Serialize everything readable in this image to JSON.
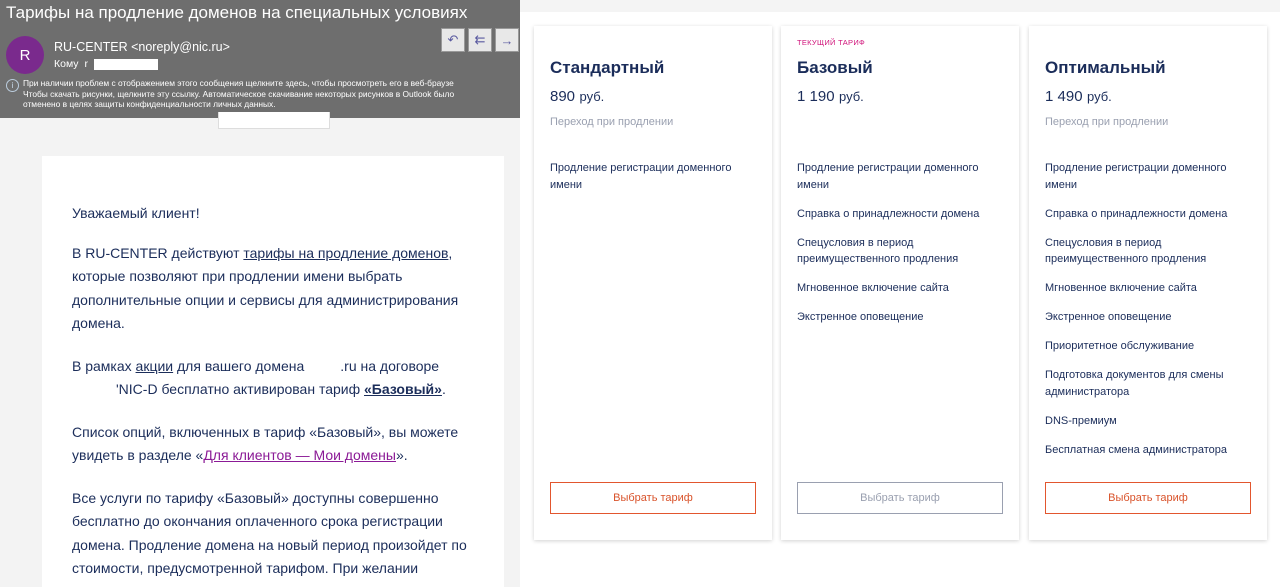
{
  "email": {
    "subject": "Тарифы на продление доменов на специальных условиях",
    "avatar_letter": "R",
    "from": "RU-CENTER <noreply@nic.ru>",
    "to_label": "Кому",
    "to_prefix": "r",
    "info_lines": [
      "При наличии проблем с отображением этого сообщения щелкните здесь, чтобы просмотреть его в веб-браузе",
      "Чтобы скачать рисунки, щелкните эту ссылку. Автоматическое скачивание некоторых рисунков в Outlook было",
      "отменено в целях защиты конфиденциальности личных данных."
    ],
    "actions": [
      "reply",
      "reply-all",
      "forward"
    ]
  },
  "letter": {
    "greeting": "Уважаемый клиент!",
    "p1_before": "В RU-CENTER действуют ",
    "p1_link": "тарифы на продление доменов",
    "p1_after": ", которые позволяют при продлении имени выбрать дополнительные опции и сервисы для администрирования домена.",
    "p2_before": "В рамках ",
    "p2_link": "акции",
    "p2_mid": " для вашего домена",
    "p2_ru": ".ru на договоре",
    "p2_contract": "'NIC-D бесплатно активирован тариф ",
    "p2_tariff": "«Базовый»",
    "p2_end": ".",
    "p3_before": "Список опций, включенных в тариф «Базовый», вы можете увидеть в разделе «",
    "p3_link": "Для клиентов — Мои домены",
    "p3_after": "».",
    "p4": "Все услуги по тарифу «Базовый» доступны совершенно бесплатно до окончания оплаченного срока регистрации домена. Продление домена на новый период произойдет по стоимости, предусмотренной тарифом. При желании"
  },
  "plans": [
    {
      "label": "",
      "name": "Стандартный",
      "price": "890",
      "currency": "руб.",
      "note": "Переход при продлении",
      "features": [
        "Продление регистрации доменного имени"
      ],
      "button": "Выбрать тариф",
      "active": true
    },
    {
      "label": "ТЕКУЩИЙ ТАРИФ",
      "name": "Базовый",
      "price": "1 190",
      "currency": "руб.",
      "note": "",
      "features": [
        "Продление регистрации доменного имени",
        "Справка о принадлежности домена",
        "Спецусловия в период преимущественного продления",
        "Мгновенное включение сайта",
        "Экстренное оповещение"
      ],
      "button": "Выбрать тариф",
      "active": false
    },
    {
      "label": "",
      "name": "Оптимальный",
      "price": "1 490",
      "currency": "руб.",
      "note": "Переход при продлении",
      "features": [
        "Продление регистрации доменного имени",
        "Справка о принадлежности домена",
        "Спецусловия в период преимущественного продления",
        "Мгновенное включение сайта",
        "Экстренное оповещение",
        "Приоритетное обслуживание",
        "Подготовка документов для смены администратора",
        "DNS-премиум",
        "Бесплатная смена администратора"
      ],
      "button": "Выбрать тариф",
      "active": true
    }
  ],
  "colors": {
    "accent": "#e2562e",
    "label": "#d0137a",
    "text": "#1b2d5a",
    "muted": "#9aa0b0",
    "visited_link": "#8b1a96"
  }
}
